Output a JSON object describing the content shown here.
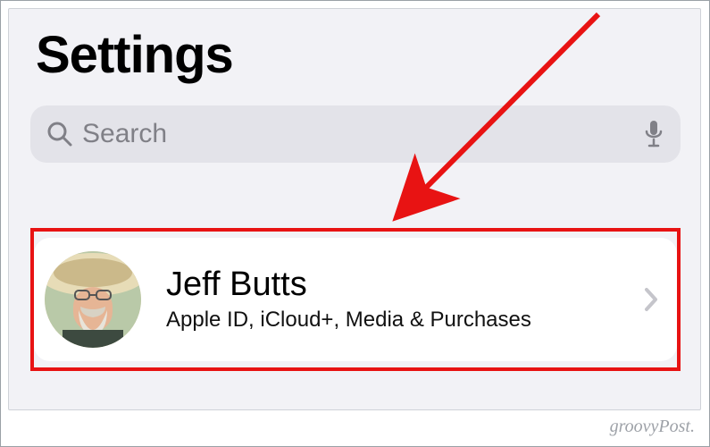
{
  "header": {
    "title": "Settings"
  },
  "search": {
    "placeholder": "Search"
  },
  "profile": {
    "name": "Jeff Butts",
    "subtitle": "Apple ID, iCloud+, Media & Purchases"
  },
  "annotation": {
    "highlight_color": "#e81313",
    "arrow_color": "#e81313"
  },
  "watermark": {
    "text": "groovyPost."
  }
}
